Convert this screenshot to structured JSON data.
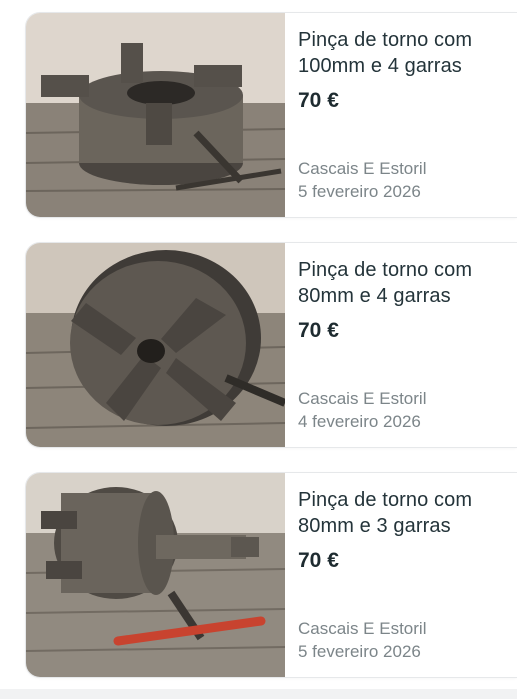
{
  "listings": [
    {
      "title_line1": "Pinça de torno com",
      "title_line2": "100mm e 4 garras",
      "price": "70 €",
      "location": "Cascais E Estoril",
      "date": "5 fevereiro 2026"
    },
    {
      "title_line1": "Pinça de torno com",
      "title_line2": "80mm e 4 garras",
      "price": "70 €",
      "location": "Cascais E Estoril",
      "date": "4 fevereiro 2026"
    },
    {
      "title_line1": "Pinça de torno com",
      "title_line2": "80mm e 3 garras",
      "price": "70 €",
      "location": "Cascais E Estoril",
      "date": "5 fevereiro 2026"
    }
  ]
}
